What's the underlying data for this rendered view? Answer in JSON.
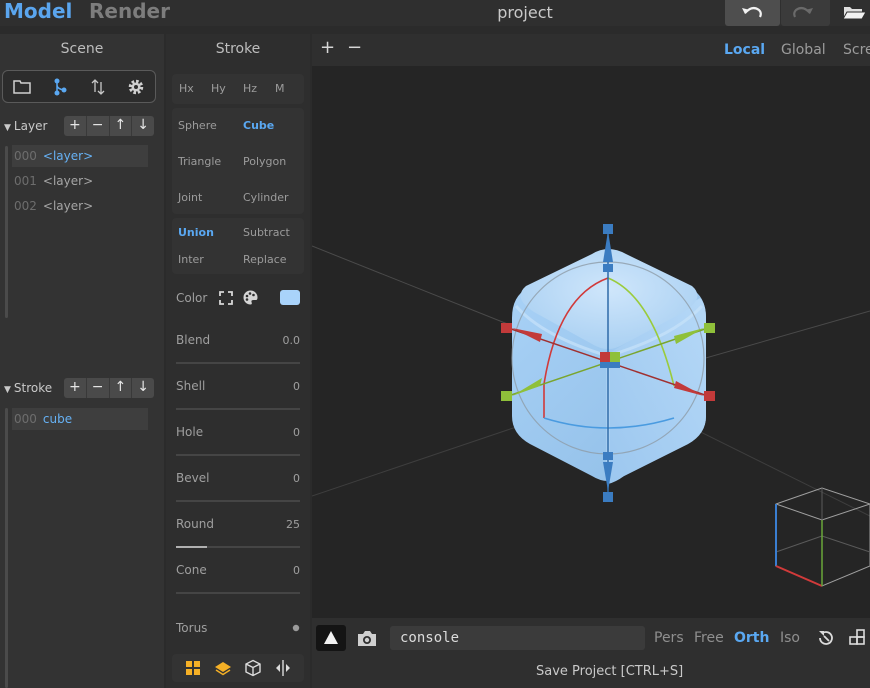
{
  "topbar": {
    "tabs": [
      "Model",
      "Render"
    ],
    "title": "project",
    "icons": [
      "undo-icon",
      "redo-icon",
      "folder-open-icon"
    ]
  },
  "scene": {
    "title": "Scene",
    "tool_icons": [
      "folder-icon",
      "hierarchy-icon",
      "sort-icon",
      "gear-icon"
    ],
    "layer_section": {
      "label": "Layer",
      "buttons": [
        "+",
        "−",
        "↑",
        "↓"
      ],
      "items": [
        {
          "idx": "000",
          "name": "<layer>"
        },
        {
          "idx": "001",
          "name": "<layer>"
        },
        {
          "idx": "002",
          "name": "<layer>"
        }
      ]
    },
    "stroke_section": {
      "label": "Stroke",
      "buttons": [
        "+",
        "−",
        "↑",
        "↓"
      ],
      "items": [
        {
          "idx": "000",
          "name": "cube"
        }
      ]
    }
  },
  "stroke": {
    "title": "Stroke",
    "mirror": [
      "Hx",
      "Hy",
      "Hz",
      "M"
    ],
    "shapes": [
      "Sphere",
      "Cube",
      "Triangle",
      "Polygon",
      "Joint",
      "Cylinder"
    ],
    "active_shape": "Cube",
    "ops": [
      "Union",
      "Subtract",
      "Inter",
      "Replace"
    ],
    "active_op": "Union",
    "color_label": "Color",
    "color": "#a9d3fa",
    "props": [
      {
        "label": "Blend",
        "value": "0.0",
        "fill": 0
      },
      {
        "label": "Shell",
        "value": "0",
        "fill": 0
      },
      {
        "label": "Hole",
        "value": "0",
        "fill": 0
      },
      {
        "label": "Bevel",
        "value": "0",
        "fill": 0
      },
      {
        "label": "Round",
        "value": "25",
        "fill": 0.25
      },
      {
        "label": "Cone",
        "value": "0",
        "fill": 0
      }
    ],
    "torus_label": "Torus",
    "bottom_icons": [
      "grid-icon",
      "layers-icon",
      "cube-icon",
      "mirror-icon"
    ]
  },
  "viewport": {
    "zoom_in": "+",
    "zoom_out": "−",
    "space_modes": [
      "Local",
      "Global",
      "Screen"
    ],
    "active_space": "Local",
    "console_placeholder": "console",
    "projections": [
      "Pers",
      "Free",
      "Orth",
      "Iso"
    ],
    "active_projection": "Orth",
    "status": "Save Project [CTRL+S]"
  }
}
